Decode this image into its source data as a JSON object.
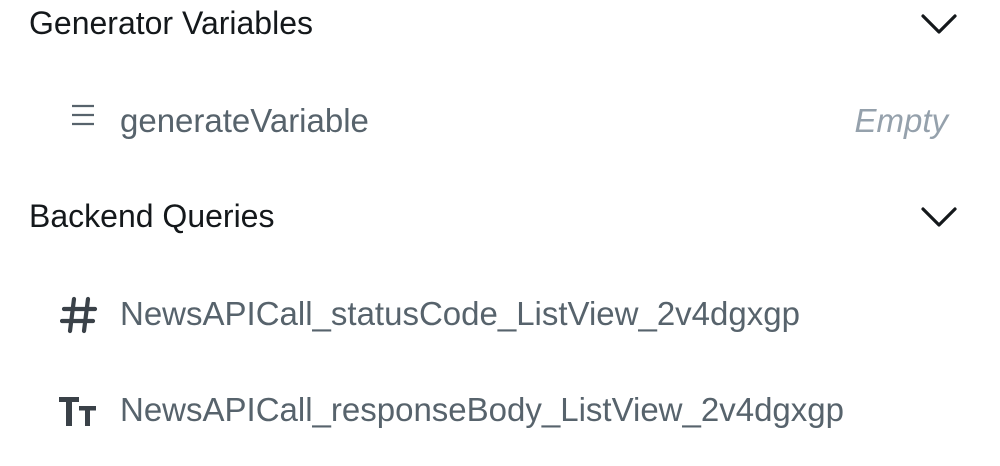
{
  "sections": [
    {
      "title": "Generator Variables",
      "chevron_icon": "chevron-down-icon",
      "items": [
        {
          "icon": "list-icon",
          "label": "generateVariable",
          "value": "Empty"
        }
      ]
    },
    {
      "title": "Backend Queries",
      "chevron_icon": "chevron-down-icon",
      "items": [
        {
          "icon": "number-icon",
          "label": "NewsAPICall_statusCode_ListView_2v4dgxgp"
        },
        {
          "icon": "text-type-icon",
          "label": "NewsAPICall_responseBody_ListView_2v4dgxgp"
        }
      ]
    }
  ],
  "colors": {
    "title": "#14181b",
    "label": "#57636c",
    "placeholder": "#95a1ac",
    "icon": "#57636c",
    "background": "#ffffff"
  }
}
